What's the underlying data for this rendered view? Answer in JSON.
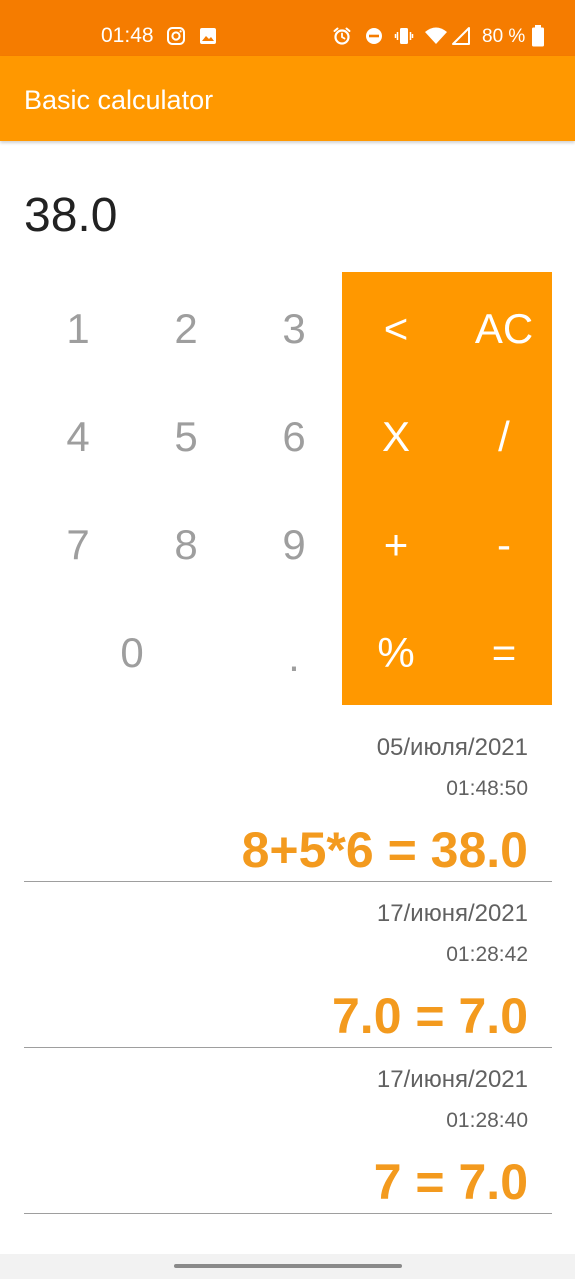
{
  "status_bar": {
    "time": "01:48",
    "battery_text": "80 %",
    "icons": [
      "instagram-icon",
      "image-icon",
      "alarm-icon",
      "do-not-disturb-icon",
      "vibrate-icon",
      "wifi-icon",
      "signal-icon",
      "battery-icon"
    ],
    "background_color": "#F57C00"
  },
  "app_bar": {
    "title": "Basic calculator",
    "background_color": "#FF9800"
  },
  "display": {
    "value": "38.0"
  },
  "keypad": {
    "digits": {
      "k1": "1",
      "k2": "2",
      "k3": "3",
      "k4": "4",
      "k5": "5",
      "k6": "6",
      "k7": "7",
      "k8": "8",
      "k9": "9",
      "k0": "0",
      "dot": "."
    },
    "operators": {
      "backspace": "<",
      "clear": "AC",
      "multiply": "X",
      "divide": "/",
      "plus": "+",
      "minus": "-",
      "percent": "%",
      "equals": "="
    },
    "operator_panel_color": "#FF9800",
    "digit_color": "#9E9E9E"
  },
  "history": [
    {
      "date": "05/июля/2021",
      "time": "01:48:50",
      "expression": "8+5*6 = 38.0"
    },
    {
      "date": "17/июня/2021",
      "time": "01:28:42",
      "expression": "7.0 = 7.0"
    },
    {
      "date": "17/июня/2021",
      "time": "01:28:40",
      "expression": "7 = 7.0"
    }
  ],
  "history_accent_color": "#F39A1E"
}
